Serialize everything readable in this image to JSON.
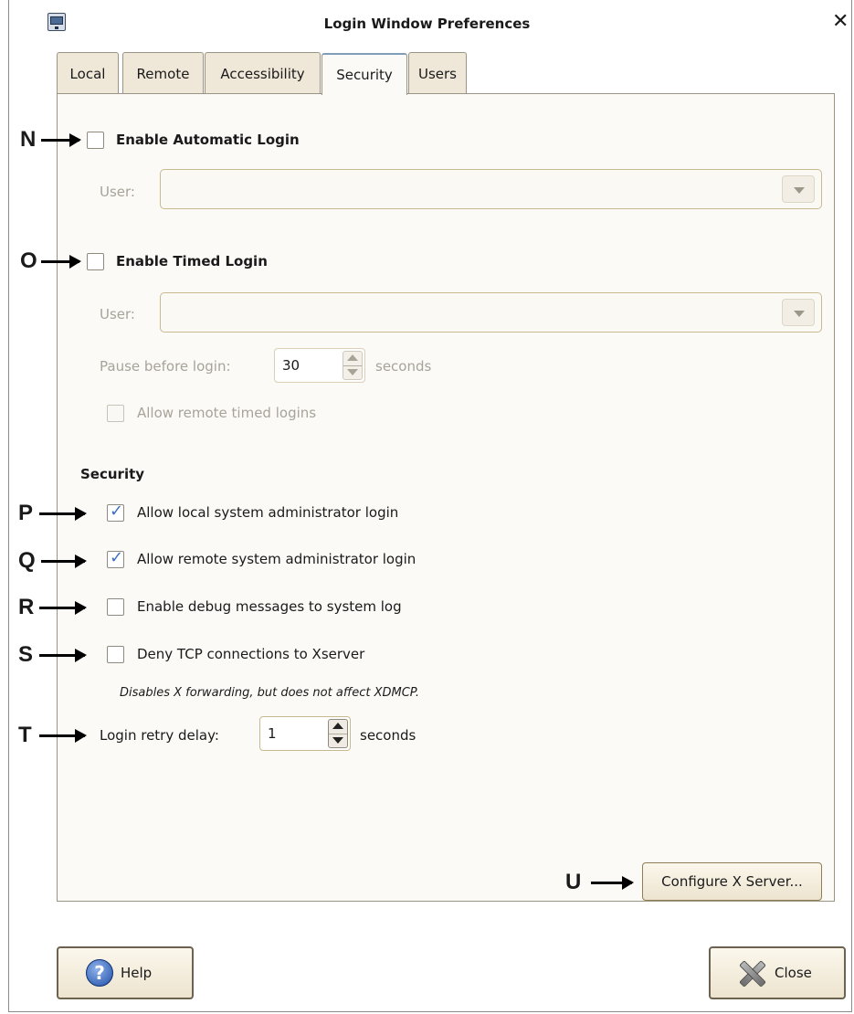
{
  "window": {
    "title": "Login Window Preferences",
    "close_glyph": "✕"
  },
  "tabs": [
    {
      "label": "Local"
    },
    {
      "label": "Remote"
    },
    {
      "label": "Accessibility"
    },
    {
      "label": "Security",
      "active": true
    },
    {
      "label": "Users"
    }
  ],
  "annotations": {
    "n": "N",
    "o": "O",
    "p": "P",
    "q": "Q",
    "r": "R",
    "s": "S",
    "t": "T",
    "u": "U"
  },
  "auto_login": {
    "checkbox_label": "Enable Automatic Login",
    "checked": false,
    "user_label": "User:",
    "user_value": ""
  },
  "timed_login": {
    "checkbox_label": "Enable Timed Login",
    "checked": false,
    "user_label": "User:",
    "user_value": "",
    "pause_label": "Pause before login:",
    "pause_value": "30",
    "pause_unit": "seconds",
    "allow_remote_label": "Allow remote timed logins",
    "allow_remote_checked": false
  },
  "security": {
    "heading": "Security",
    "options": [
      {
        "label": "Allow local system administrator login",
        "checked": true
      },
      {
        "label": "Allow remote system administrator login",
        "checked": true
      },
      {
        "label": "Enable debug messages to system log",
        "checked": false
      },
      {
        "label": "Deny TCP connections to Xserver",
        "checked": false
      }
    ],
    "deny_tcp_note": "Disables X forwarding, but does not affect XDMCP.",
    "retry_label": "Login retry delay:",
    "retry_value": "1",
    "retry_unit": "seconds"
  },
  "buttons": {
    "configure": "Configure X Server...",
    "help": "Help",
    "close": "Close"
  },
  "icons": {
    "app": "login-window-app-icon",
    "help": "help-question-icon",
    "close": "close-x-icon",
    "combo_arrow": "chevron-down-icon"
  },
  "colors": {
    "checkmark": "#3d6fc4",
    "active_tab_border": "#7f9db9"
  }
}
